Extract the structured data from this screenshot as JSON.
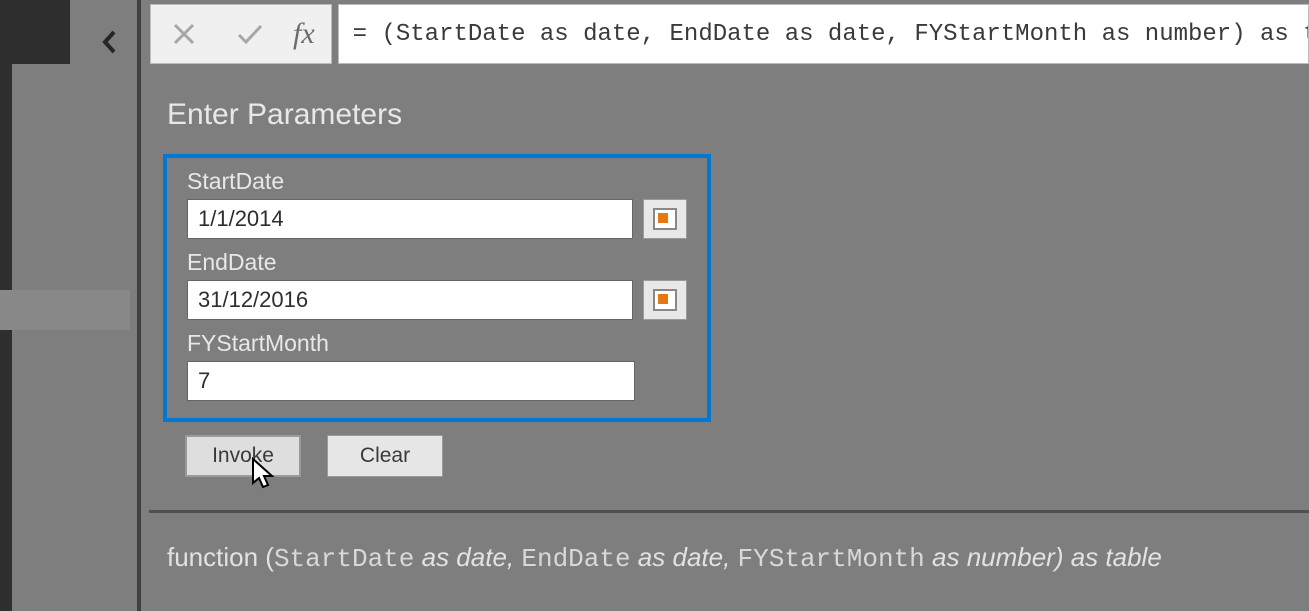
{
  "formula_bar": {
    "fx_label": "fx",
    "formula": "= (StartDate as date, EndDate as date, FYStartMonth as number) as table"
  },
  "params": {
    "title": "Enter Parameters",
    "fields": [
      {
        "label": "StartDate",
        "value": "1/1/2014",
        "has_calendar": true
      },
      {
        "label": "EndDate",
        "value": "31/12/2016",
        "has_calendar": true
      },
      {
        "label": "FYStartMonth",
        "value": "7",
        "has_calendar": false
      }
    ]
  },
  "buttons": {
    "invoke": "Invoke",
    "clear": "Clear"
  },
  "signature": {
    "prefix": "function (",
    "p1_name": "StartDate",
    "p1_type": " as date, ",
    "p2_name": "EndDate",
    "p2_type": " as date, ",
    "p3_name": "FYStartMonth",
    "p3_type": " as number) as table"
  }
}
